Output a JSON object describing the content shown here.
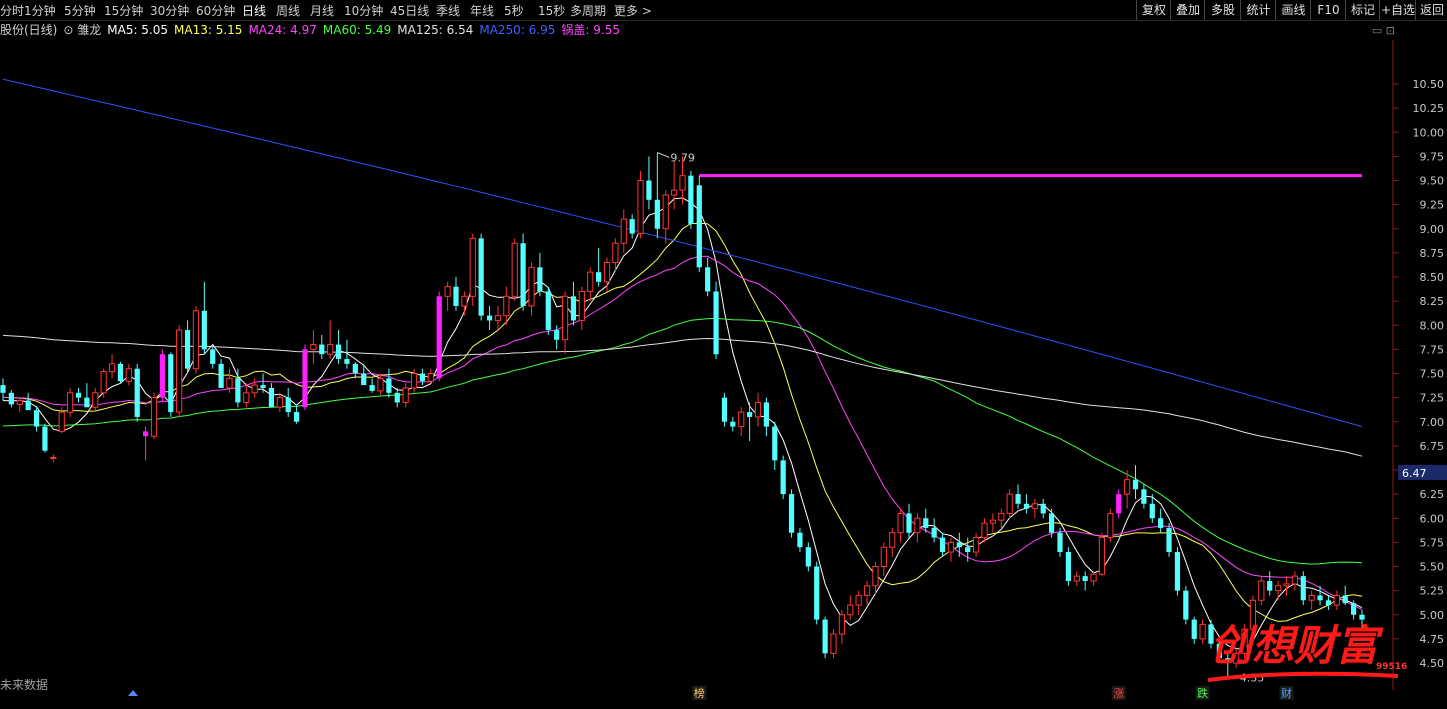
{
  "toolbar": {
    "left_tabs": [
      "分时",
      "1分钟",
      "5分钟",
      "15分钟",
      "30分钟",
      "60分钟",
      "日线",
      "周线",
      "月线",
      "10分钟",
      "45日线",
      "季线",
      "年线",
      "5秒",
      "15秒",
      "多周期",
      "更多 >"
    ],
    "active_tab": "日线",
    "right_buttons": [
      "复权",
      "叠加",
      "多股",
      "统计",
      "画线",
      "F10",
      "标记",
      "+自选",
      "返回"
    ]
  },
  "legend": {
    "title": "股份(日线)",
    "indicator": "雏龙",
    "items": [
      {
        "label": "MA5: 5.05",
        "color": "#ffffff"
      },
      {
        "label": "MA13: 5.15",
        "color": "#ffff55"
      },
      {
        "label": "MA24: 4.97",
        "color": "#ff44ff"
      },
      {
        "label": "MA60: 5.49",
        "color": "#44ff44"
      },
      {
        "label": "MA125: 6.54",
        "color": "#e0e0e0"
      },
      {
        "label": "MA250: 6.95",
        "color": "#4060ff"
      },
      {
        "label": "锅盖: 9.55",
        "color": "#ff44ff"
      }
    ]
  },
  "axis_extra": {
    "current_price_tag": "6.47",
    "high_label": "9.79",
    "low_label": "4.35"
  },
  "markers": [
    "榜",
    "涨",
    "跌",
    "财"
  ],
  "bottom_label": "未来数据",
  "watermark": {
    "text": "创想财富",
    "site": "995168.cn"
  },
  "chart_data": {
    "type": "candlestick",
    "y_ticks": [
      4.5,
      4.75,
      5.0,
      5.25,
      5.5,
      5.75,
      6.0,
      6.25,
      6.5,
      6.75,
      7.0,
      7.25,
      7.5,
      7.75,
      8.0,
      8.25,
      8.5,
      8.75,
      9.0,
      9.25,
      9.5,
      9.75,
      10.0,
      10.25,
      10.5
    ],
    "ylim": [
      4.25,
      10.95
    ],
    "guokai": 9.55,
    "guokai_start_index": 83,
    "colors": {
      "up": "#ff3333",
      "down": "#55ffff",
      "limit": "#ff22ff"
    },
    "limit_up_indices": [
      17,
      19,
      36,
      52,
      133
    ],
    "marker_indices": [
      83,
      133,
      143,
      153
    ],
    "candles": [
      [
        7.38,
        7.45,
        7.22,
        7.3
      ],
      [
        7.3,
        7.33,
        7.15,
        7.18
      ],
      [
        7.18,
        7.25,
        7.1,
        7.22
      ],
      [
        7.22,
        7.3,
        7.15,
        7.12
      ],
      [
        7.12,
        7.15,
        6.9,
        6.95
      ],
      [
        6.95,
        6.98,
        6.68,
        6.7
      ],
      [
        6.62,
        6.66,
        6.58,
        6.63
      ],
      [
        6.9,
        7.15,
        6.88,
        7.1
      ],
      [
        7.1,
        7.35,
        7.05,
        7.3
      ],
      [
        7.3,
        7.35,
        7.2,
        7.25
      ],
      [
        7.25,
        7.4,
        7.2,
        7.15
      ],
      [
        7.15,
        7.35,
        7.1,
        7.3
      ],
      [
        7.3,
        7.55,
        7.25,
        7.52
      ],
      [
        7.52,
        7.7,
        7.45,
        7.6
      ],
      [
        7.6,
        7.62,
        7.4,
        7.42
      ],
      [
        7.42,
        7.6,
        7.38,
        7.55
      ],
      [
        7.55,
        7.6,
        7.0,
        7.05
      ],
      [
        6.9,
        6.95,
        6.6,
        6.85
      ],
      [
        6.85,
        7.3,
        6.82,
        7.25
      ],
      [
        7.25,
        7.75,
        7.2,
        7.7
      ],
      [
        7.7,
        7.72,
        7.05,
        7.1
      ],
      [
        7.1,
        8.0,
        7.05,
        7.95
      ],
      [
        7.95,
        8.05,
        7.5,
        7.55
      ],
      [
        7.55,
        8.2,
        7.5,
        8.15
      ],
      [
        8.15,
        8.45,
        7.7,
        7.75
      ],
      [
        7.75,
        7.78,
        7.55,
        7.6
      ],
      [
        7.6,
        7.65,
        7.4,
        7.35
      ],
      [
        7.35,
        7.55,
        7.3,
        7.45
      ],
      [
        7.45,
        7.55,
        7.15,
        7.2
      ],
      [
        7.2,
        7.4,
        7.15,
        7.3
      ],
      [
        7.3,
        7.45,
        7.25,
        7.38
      ],
      [
        7.38,
        7.5,
        7.3,
        7.35
      ],
      [
        7.35,
        7.4,
        7.2,
        7.15
      ],
      [
        7.15,
        7.3,
        7.1,
        7.25
      ],
      [
        7.25,
        7.35,
        7.05,
        7.1
      ],
      [
        7.1,
        7.18,
        6.98,
        7.0
      ],
      [
        7.15,
        7.8,
        7.12,
        7.75
      ],
      [
        7.75,
        7.95,
        7.6,
        7.8
      ],
      [
        7.8,
        7.9,
        7.65,
        7.7
      ],
      [
        7.7,
        8.05,
        7.65,
        7.8
      ],
      [
        7.8,
        7.95,
        7.6,
        7.65
      ],
      [
        7.65,
        7.85,
        7.55,
        7.6
      ],
      [
        7.6,
        7.62,
        7.45,
        7.5
      ],
      [
        7.5,
        7.6,
        7.4,
        7.38
      ],
      [
        7.38,
        7.45,
        7.3,
        7.32
      ],
      [
        7.32,
        7.5,
        7.28,
        7.45
      ],
      [
        7.45,
        7.55,
        7.25,
        7.3
      ],
      [
        7.3,
        7.35,
        7.15,
        7.2
      ],
      [
        7.2,
        7.4,
        7.15,
        7.35
      ],
      [
        7.35,
        7.55,
        7.3,
        7.5
      ],
      [
        7.5,
        7.55,
        7.38,
        7.42
      ],
      [
        7.42,
        7.55,
        7.4,
        7.5
      ],
      [
        7.45,
        8.35,
        7.42,
        8.3
      ],
      [
        8.3,
        8.45,
        8.15,
        8.4
      ],
      [
        8.4,
        8.5,
        8.15,
        8.2
      ],
      [
        8.2,
        8.35,
        8.1,
        8.3
      ],
      [
        8.3,
        8.95,
        8.2,
        8.9
      ],
      [
        8.9,
        8.95,
        8.05,
        8.1
      ],
      [
        8.1,
        8.2,
        7.95,
        8.05
      ],
      [
        8.05,
        8.2,
        7.95,
        8.1
      ],
      [
        8.1,
        8.4,
        8.0,
        8.3
      ],
      [
        8.3,
        8.9,
        8.25,
        8.85
      ],
      [
        8.85,
        8.95,
        8.15,
        8.2
      ],
      [
        8.2,
        8.65,
        8.1,
        8.6
      ],
      [
        8.6,
        8.75,
        8.3,
        8.35
      ],
      [
        8.35,
        8.4,
        7.9,
        7.95
      ],
      [
        7.95,
        8.0,
        7.75,
        7.85
      ],
      [
        7.85,
        8.35,
        7.7,
        8.3
      ],
      [
        8.3,
        8.45,
        8.0,
        8.05
      ],
      [
        8.05,
        8.4,
        7.95,
        8.35
      ],
      [
        8.35,
        8.6,
        8.25,
        8.55
      ],
      [
        8.55,
        8.8,
        8.4,
        8.45
      ],
      [
        8.45,
        8.7,
        8.35,
        8.65
      ],
      [
        8.65,
        8.9,
        8.55,
        8.85
      ],
      [
        8.85,
        9.2,
        8.75,
        9.1
      ],
      [
        9.1,
        9.15,
        8.9,
        8.95
      ],
      [
        8.95,
        9.6,
        8.9,
        9.5
      ],
      [
        9.5,
        9.75,
        9.2,
        9.3
      ],
      [
        9.3,
        9.79,
        8.9,
        9.0
      ],
      [
        9.0,
        9.4,
        8.85,
        9.35
      ],
      [
        9.35,
        9.7,
        9.2,
        9.4
      ],
      [
        9.4,
        9.75,
        9.25,
        9.55
      ],
      [
        9.55,
        9.6,
        9.0,
        9.05
      ],
      [
        9.45,
        9.55,
        8.55,
        8.6
      ],
      [
        8.6,
        8.7,
        8.3,
        8.35
      ],
      [
        8.35,
        8.45,
        7.65,
        7.7
      ],
      [
        7.25,
        7.3,
        6.95,
        7.0
      ],
      [
        7.0,
        7.05,
        6.9,
        6.95
      ],
      [
        6.95,
        7.15,
        6.85,
        7.1
      ],
      [
        7.1,
        7.2,
        6.8,
        7.05
      ],
      [
        7.05,
        7.3,
        6.95,
        7.2
      ],
      [
        7.2,
        7.25,
        6.85,
        6.95
      ],
      [
        6.95,
        7.0,
        6.5,
        6.6
      ],
      [
        6.6,
        6.65,
        6.2,
        6.25
      ],
      [
        6.25,
        6.3,
        5.8,
        5.85
      ],
      [
        5.85,
        5.9,
        5.65,
        5.7
      ],
      [
        5.7,
        5.75,
        5.45,
        5.5
      ],
      [
        5.5,
        5.55,
        4.9,
        4.95
      ],
      [
        4.95,
        4.98,
        4.55,
        4.6
      ],
      [
        4.6,
        4.85,
        4.55,
        4.8
      ],
      [
        4.8,
        5.05,
        4.7,
        5.0
      ],
      [
        5.0,
        5.2,
        4.95,
        5.1
      ],
      [
        5.1,
        5.25,
        5.0,
        5.2
      ],
      [
        5.2,
        5.35,
        5.1,
        5.3
      ],
      [
        5.3,
        5.55,
        5.2,
        5.5
      ],
      [
        5.5,
        5.75,
        5.4,
        5.7
      ],
      [
        5.7,
        5.9,
        5.6,
        5.85
      ],
      [
        5.85,
        6.1,
        5.75,
        6.05
      ],
      [
        6.05,
        6.15,
        5.8,
        5.85
      ],
      [
        5.85,
        6.05,
        5.75,
        6.0
      ],
      [
        6.0,
        6.1,
        5.85,
        5.9
      ],
      [
        5.9,
        6.0,
        5.75,
        5.8
      ],
      [
        5.8,
        5.85,
        5.6,
        5.65
      ],
      [
        5.65,
        5.8,
        5.55,
        5.75
      ],
      [
        5.75,
        5.85,
        5.6,
        5.7
      ],
      [
        5.7,
        5.8,
        5.55,
        5.65
      ],
      [
        5.65,
        5.85,
        5.6,
        5.8
      ],
      [
        5.8,
        6.0,
        5.75,
        5.95
      ],
      [
        5.95,
        6.05,
        5.85,
        5.98
      ],
      [
        5.98,
        6.1,
        5.9,
        6.05
      ],
      [
        6.05,
        6.3,
        6.0,
        6.25
      ],
      [
        6.25,
        6.35,
        6.1,
        6.15
      ],
      [
        6.15,
        6.25,
        6.05,
        6.1
      ],
      [
        6.1,
        6.2,
        6.0,
        6.15
      ],
      [
        6.15,
        6.2,
        6.0,
        6.05
      ],
      [
        6.05,
        6.1,
        5.8,
        5.85
      ],
      [
        5.85,
        5.9,
        5.6,
        5.65
      ],
      [
        5.65,
        5.7,
        5.3,
        5.35
      ],
      [
        5.35,
        5.45,
        5.3,
        5.4
      ],
      [
        5.4,
        5.45,
        5.25,
        5.35
      ],
      [
        5.35,
        5.45,
        5.3,
        5.42
      ],
      [
        5.42,
        5.85,
        5.4,
        5.8
      ],
      [
        5.8,
        6.1,
        5.75,
        6.05
      ],
      [
        6.05,
        6.3,
        6.0,
        6.25
      ],
      [
        6.25,
        6.5,
        6.1,
        6.4
      ],
      [
        6.4,
        6.55,
        6.2,
        6.3
      ],
      [
        6.3,
        6.35,
        6.1,
        6.15
      ],
      [
        6.15,
        6.25,
        5.95,
        6.0
      ],
      [
        6.0,
        6.1,
        5.85,
        5.9
      ],
      [
        5.9,
        5.95,
        5.6,
        5.65
      ],
      [
        5.65,
        5.7,
        5.2,
        5.25
      ],
      [
        5.25,
        5.3,
        4.9,
        4.95
      ],
      [
        4.95,
        4.98,
        4.7,
        4.75
      ],
      [
        4.75,
        4.95,
        4.7,
        4.9
      ],
      [
        4.9,
        4.95,
        4.65,
        4.7
      ],
      [
        4.7,
        4.75,
        4.5,
        4.55
      ],
      [
        4.55,
        4.6,
        4.35,
        4.5
      ],
      [
        4.5,
        4.65,
        4.45,
        4.6
      ],
      [
        4.6,
        4.9,
        4.55,
        4.85
      ],
      [
        4.85,
        5.2,
        4.8,
        5.15
      ],
      [
        5.15,
        5.4,
        5.1,
        5.35
      ],
      [
        5.35,
        5.45,
        5.2,
        5.25
      ],
      [
        5.25,
        5.35,
        5.15,
        5.3
      ],
      [
        5.3,
        5.4,
        5.2,
        5.32
      ],
      [
        5.32,
        5.45,
        5.25,
        5.4
      ],
      [
        5.4,
        5.45,
        5.1,
        5.15
      ],
      [
        5.15,
        5.25,
        5.05,
        5.2
      ],
      [
        5.2,
        5.3,
        5.1,
        5.15
      ],
      [
        5.15,
        5.2,
        5.05,
        5.1
      ],
      [
        5.1,
        5.25,
        5.05,
        5.2
      ],
      [
        5.2,
        5.3,
        5.1,
        5.12
      ],
      [
        5.12,
        5.15,
        4.95,
        5.0
      ],
      [
        5.0,
        5.05,
        4.85,
        4.95
      ]
    ]
  }
}
